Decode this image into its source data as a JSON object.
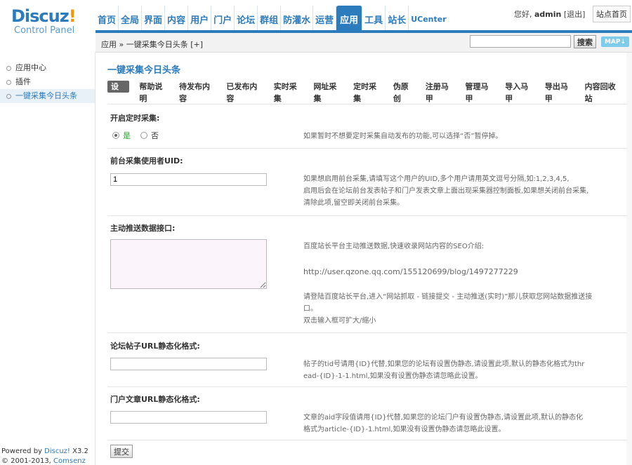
{
  "logo": {
    "main": "Discuz",
    "bang": "!",
    "sub": "Control Panel"
  },
  "topnav": [
    {
      "label": "首页"
    },
    {
      "label": "全局"
    },
    {
      "label": "界面"
    },
    {
      "label": "内容"
    },
    {
      "label": "用户"
    },
    {
      "label": "门户"
    },
    {
      "label": "论坛"
    },
    {
      "label": "群组"
    },
    {
      "label": "防灌水"
    },
    {
      "label": "运营"
    },
    {
      "label": "应用",
      "active": true
    },
    {
      "label": "工具"
    },
    {
      "label": "站长"
    },
    {
      "label": "UCenter"
    }
  ],
  "user": {
    "greeting": "您好,",
    "name": "admin",
    "logout": "[退出]",
    "site_home": "站点首页"
  },
  "breadcrumb": "应用 » 一键采集今日头条 [+]",
  "search": {
    "button": "搜索",
    "map": "MAP"
  },
  "sidebar": {
    "items": [
      {
        "label": "应用中心"
      },
      {
        "label": "插件"
      },
      {
        "label": "一键采集今日头条",
        "active": true
      }
    ],
    "powered_prefix": "Powered by ",
    "powered_brand": "Discuz!",
    "powered_version": " X3.2",
    "copyright_prefix": "© 2001-2013, ",
    "copyright_brand": "Comsenz Inc."
  },
  "page": {
    "title": "一键采集今日头条",
    "tabs": [
      "设置",
      "帮助说明",
      "待发布内容",
      "已发布内容",
      "实时采集",
      "网址采集",
      "定时采集",
      "伪原创",
      "注册马甲",
      "管理马甲",
      "导入马甲",
      "导出马甲",
      "内容回收站"
    ],
    "fields": {
      "timer": {
        "label": "开启定时采集:",
        "yes": "是",
        "no": "否",
        "tip": "如果暂时不想要定时采集自动发布的功能,可以选择“否”暂停掉。"
      },
      "uid": {
        "label": "前台采集使用者UID:",
        "value": "1",
        "tip1": "如果想启用前台采集,请填写这个用户的UID,多个用户请用英文逗号分隔,如:1,2,3,4,5,",
        "tip2": "启用后会在论坛前台发表帖子和门户发表文章上面出现采集器控制面板,如果想关闭前台采集,",
        "tip3": "清除此项,留空即关闭前台采集。"
      },
      "push": {
        "label": "主动推送数据接口:",
        "tip1": "百度站长平台主动推送数据,快速收录网站内容的SEO介绍:",
        "tip2": "http://user.qzone.qq.com/155120699/blog/1497277229",
        "tip3": "请登陆百度站长平台,进入“网站抓取 - 链接提交 - 主动推送(实时)”那儿获取您网站数据推送接",
        "tip4": "口。",
        "tip5": "双击输入框可扩大/缩小"
      },
      "forum_url": {
        "label": "论坛帖子URL静态化格式:",
        "tip1": "帖子的tid号请用{ID}代替,如果您的论坛有设置伪静态,请设置此项,默认的静态化格式为thr",
        "tip2": "ead-{ID}-1-1.html,如果没有设置伪静态请忽略此设置。"
      },
      "portal_url": {
        "label": "门户文章URL静态化格式:",
        "tip1": "文章的aid字段值请用{ID}代替,如果您的论坛门户有设置伪静态,请设置此项,默认的静态化",
        "tip2": "格式为article-{ID}-1.html,如果没有设置伪静态请忽略此设置。"
      }
    },
    "submit": "提交"
  }
}
